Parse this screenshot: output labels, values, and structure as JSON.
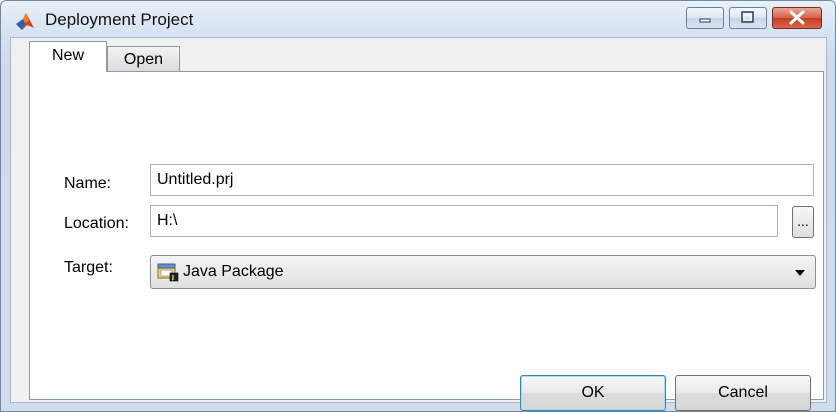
{
  "window": {
    "title": "Deployment Project"
  },
  "tabs": [
    {
      "label": "New",
      "active": true
    },
    {
      "label": "Open",
      "active": false
    }
  ],
  "form": {
    "name_label": "Name:",
    "name_value": "Untitled.prj",
    "location_label": "Location:",
    "location_value": "H:\\",
    "browse_label": "...",
    "target_label": "Target:",
    "target_value": "Java Package",
    "target_icon": "java-package-icon"
  },
  "buttons": {
    "ok": "OK",
    "cancel": "Cancel"
  },
  "colors": {
    "accent": "#3c7fb1",
    "close_button": "#c43b22"
  }
}
